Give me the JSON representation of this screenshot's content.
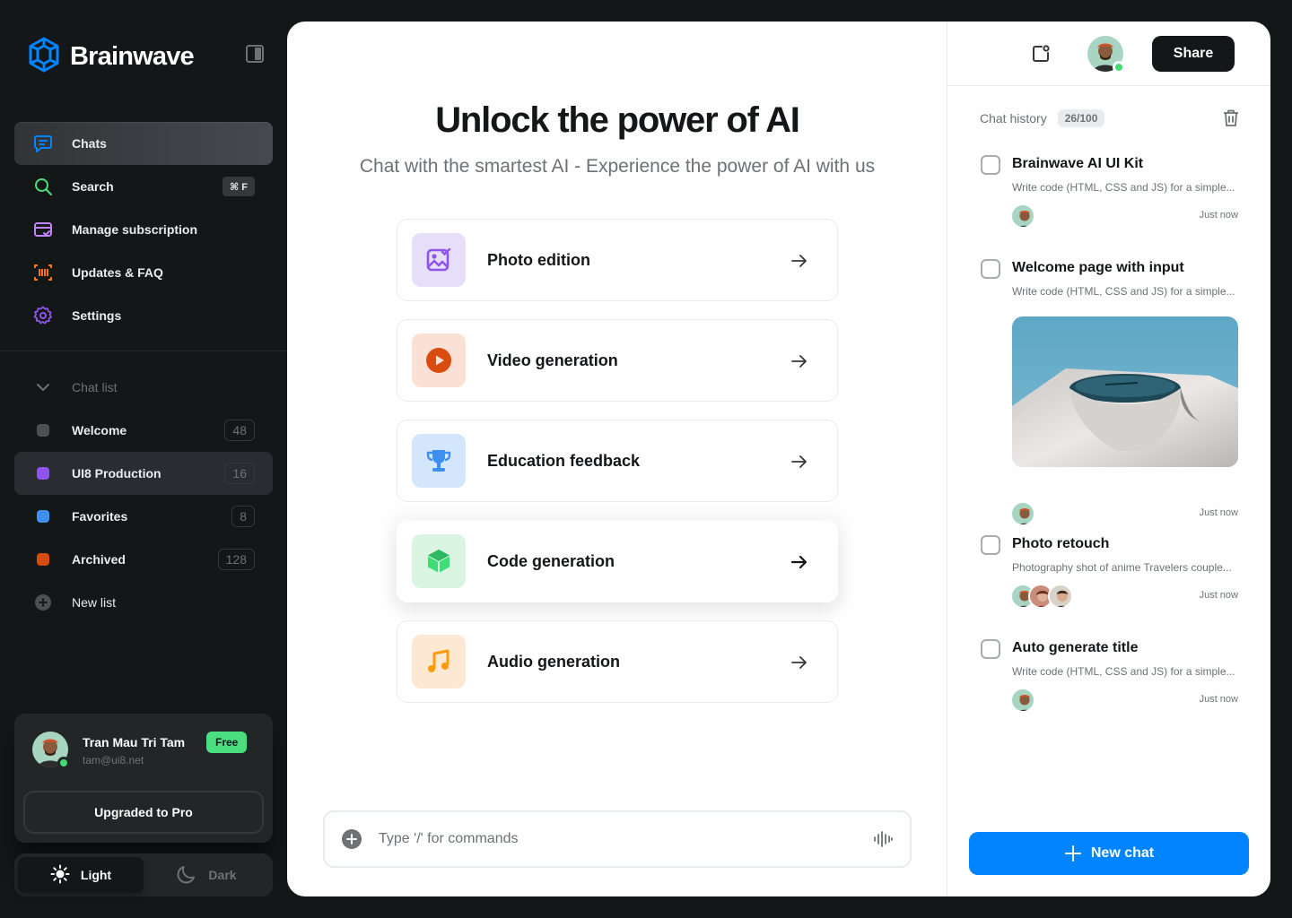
{
  "brand": {
    "name": "Brainwave"
  },
  "nav": {
    "items": [
      {
        "label": "Chats",
        "icon": "chat-icon",
        "color": "#0084ff"
      },
      {
        "label": "Search",
        "icon": "search-icon",
        "color": "#4ade80",
        "shortcut": "⌘ F"
      },
      {
        "label": "Manage subscription",
        "icon": "card-icon",
        "color": "#c084fc"
      },
      {
        "label": "Updates & FAQ",
        "icon": "barcode-icon",
        "color": "#f97316"
      },
      {
        "label": "Settings",
        "icon": "gear-icon",
        "color": "#8e55ea"
      }
    ]
  },
  "chat_lists": {
    "heading": "Chat list",
    "items": [
      {
        "label": "Welcome",
        "count": "48",
        "color": "#4b5054"
      },
      {
        "label": "UI8 Production",
        "count": "16",
        "color": "#8e55ea"
      },
      {
        "label": "Favorites",
        "count": "8",
        "color": "#3e90f0"
      },
      {
        "label": "Archived",
        "count": "128",
        "color": "#d84c10"
      }
    ],
    "new_list": "New list"
  },
  "user": {
    "name": "Tran Mau Tri Tam",
    "email": "tam@ui8.net",
    "plan": "Free",
    "upgrade_label": "Upgraded to Pro"
  },
  "theme": {
    "light": "Light",
    "dark": "Dark",
    "selected": "Light"
  },
  "hero": {
    "title": "Unlock the power of AI",
    "subtitle": "Chat with the smartest AI - Experience the power of AI with us"
  },
  "features": [
    {
      "label": "Photo edition",
      "icon": "photo-icon",
      "color": "#8e55ea"
    },
    {
      "label": "Video generation",
      "icon": "play-icon",
      "color": "#d84c10"
    },
    {
      "label": "Education feedback",
      "icon": "trophy-icon",
      "color": "#3e90f0"
    },
    {
      "label": "Code generation",
      "icon": "cube-icon",
      "color": "#3fdd78"
    },
    {
      "label": "Audio generation",
      "icon": "music-icon",
      "color": "#ff9a0b"
    }
  ],
  "composer": {
    "placeholder": "Type '/' for commands"
  },
  "header": {
    "share_label": "Share"
  },
  "history": {
    "heading": "Chat history",
    "count": "26/100",
    "items": [
      {
        "title": "Brainwave AI UI Kit",
        "desc": "Write code (HTML, CSS and JS) for a simple...",
        "time": "Just now"
      },
      {
        "title": "Welcome page with input",
        "desc": "Write code (HTML, CSS and JS) for a simple...",
        "time": "Just now"
      },
      {
        "title": "Photo retouch",
        "desc": "Photography shot of anime Travelers couple...",
        "time": "Just now"
      },
      {
        "title": "Auto generate title",
        "desc": "Write code (HTML, CSS and JS) for a simple...",
        "time": "Just now"
      }
    ],
    "new_chat_label": "New chat"
  }
}
